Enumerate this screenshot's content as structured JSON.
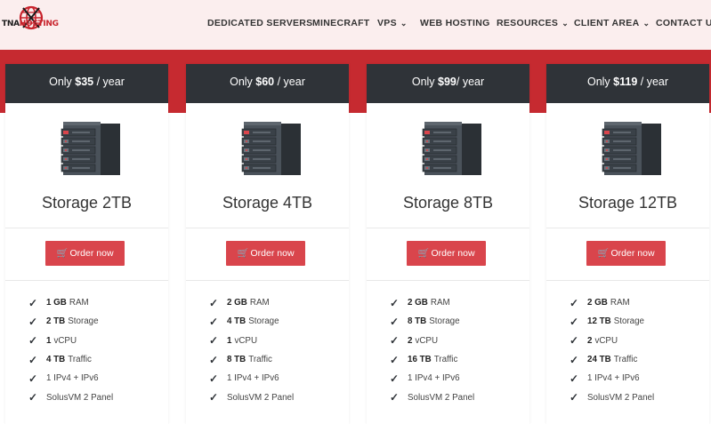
{
  "header": {
    "logo": {
      "tna": "TNA",
      "hosting": "HOSTING"
    },
    "nav": [
      {
        "label": "DEDICATED SERVERS",
        "dropdown": false
      },
      {
        "label": "MINECRAFT",
        "dropdown": false
      },
      {
        "label": "VPS",
        "dropdown": true
      },
      {
        "label": "WEB HOSTING",
        "dropdown": false
      },
      {
        "label": "RESOURCES",
        "dropdown": true
      },
      {
        "label": "CLIENT AREA",
        "dropdown": true
      },
      {
        "label": "CONTACT US",
        "dropdown": false
      }
    ]
  },
  "colors": {
    "accent": "#c62a30",
    "button": "#d9454c",
    "header_dark": "#2f3338",
    "topbar": "#fbeeee"
  },
  "plans": [
    {
      "price_prefix": "Only ",
      "price": "$35",
      "price_suffix": " / year",
      "title": "Storage 2TB",
      "button": "Order now",
      "features": [
        {
          "bold": "1 GB",
          "text": "RAM"
        },
        {
          "bold": "2 TB",
          "text": "Storage"
        },
        {
          "bold": "1",
          "text": "vCPU"
        },
        {
          "bold": "4 TB",
          "text": "Traffic"
        },
        {
          "bold": "",
          "text": "1 IPv4 + IPv6"
        },
        {
          "bold": "",
          "text": "SolusVM 2 Panel"
        }
      ]
    },
    {
      "price_prefix": "Only ",
      "price": "$60",
      "price_suffix": " / year",
      "title": "Storage 4TB",
      "button": "Order now",
      "features": [
        {
          "bold": "2 GB",
          "text": "RAM"
        },
        {
          "bold": "4 TB",
          "text": "Storage"
        },
        {
          "bold": "1",
          "text": "vCPU"
        },
        {
          "bold": "8 TB",
          "text": "Traffic"
        },
        {
          "bold": "",
          "text": "1 IPv4 + IPv6"
        },
        {
          "bold": "",
          "text": "SolusVM 2 Panel"
        }
      ]
    },
    {
      "price_prefix": "Only ",
      "price": "$99",
      "price_suffix": "/ year",
      "title": "Storage 8TB",
      "button": "Order now",
      "features": [
        {
          "bold": "2 GB",
          "text": "RAM"
        },
        {
          "bold": "8 TB",
          "text": "Storage"
        },
        {
          "bold": "2",
          "text": "vCPU"
        },
        {
          "bold": "16 TB",
          "text": "Traffic"
        },
        {
          "bold": "",
          "text": "1 IPv4 + IPv6"
        },
        {
          "bold": "",
          "text": "SolusVM 2 Panel"
        }
      ]
    },
    {
      "price_prefix": "Only ",
      "price": "$119",
      "price_suffix": " / year",
      "title": "Storage 12TB",
      "button": "Order now",
      "features": [
        {
          "bold": "2 GB",
          "text": "RAM"
        },
        {
          "bold": "12 TB",
          "text": "Storage"
        },
        {
          "bold": "2",
          "text": "vCPU"
        },
        {
          "bold": "24 TB",
          "text": "Traffic"
        },
        {
          "bold": "",
          "text": "1 IPv4 + IPv6"
        },
        {
          "bold": "",
          "text": "SolusVM 2 Panel"
        }
      ]
    }
  ]
}
